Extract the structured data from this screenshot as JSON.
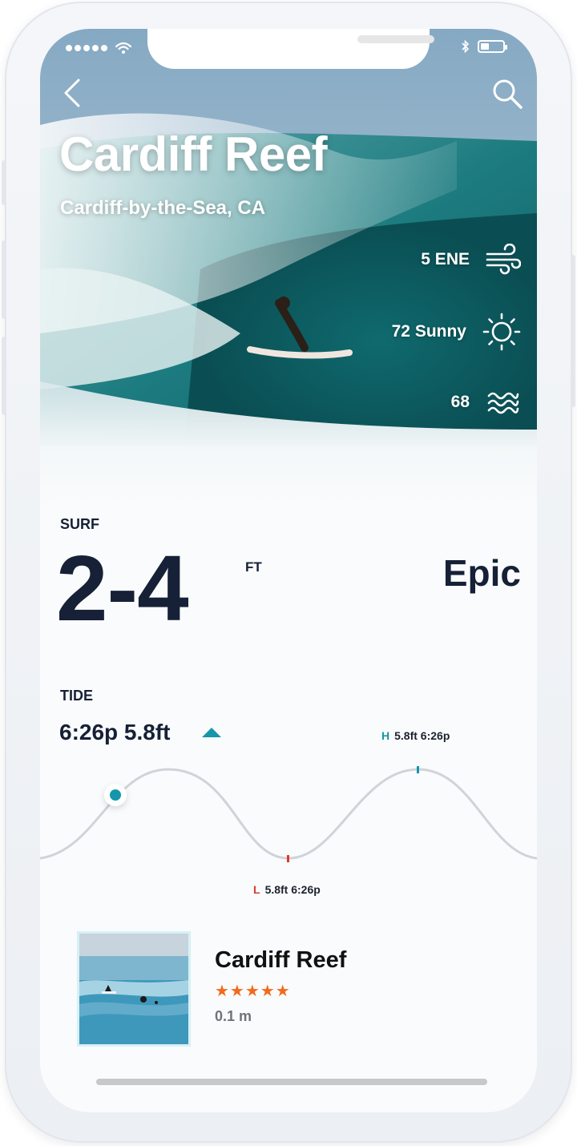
{
  "status_bar": {
    "wifi_icon": "wifi-icon",
    "bluetooth_icon": "bluetooth-icon",
    "battery_icon": "battery-icon"
  },
  "nav": {
    "back_icon": "chevron-left-icon",
    "search_icon": "search-icon"
  },
  "spot": {
    "name": "Cardiff Reef",
    "location": "Cardiff-by-the-Sea, CA"
  },
  "conditions": {
    "wind": {
      "value": "5 ENE",
      "icon": "wind-icon"
    },
    "weather": {
      "value": "72 Sunny",
      "icon": "sun-icon"
    },
    "water": {
      "value": "68",
      "icon": "waves-icon"
    }
  },
  "surf": {
    "label": "SURF",
    "range": "2-4",
    "unit": "FT",
    "rating": "Epic"
  },
  "tide": {
    "label": "TIDE",
    "current": "6:26p 5.8ft",
    "trend": "rising",
    "high": {
      "marker": "H",
      "value": "5.8ft 6:26p"
    },
    "low": {
      "marker": "L",
      "value": "5.8ft 6:26p"
    }
  },
  "card": {
    "name": "Cardiff Reef",
    "stars": "★★★★★",
    "rating": 5,
    "distance": "0.1 m"
  },
  "colors": {
    "accent": "#1596ab",
    "low_tide": "#d93b2b",
    "star": "#f26a1b",
    "text_dark": "#162036"
  }
}
